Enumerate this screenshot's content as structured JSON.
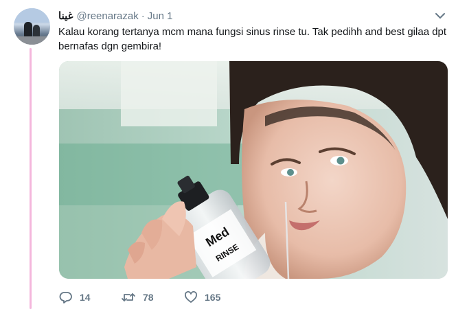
{
  "tweet": {
    "display_name": "غينا",
    "handle": "@reenarazak",
    "separator": "·",
    "date": "Jun 1",
    "text": "Kalau korang tertanya mcm mana fungsi sinus rinse tu. Tak pedihh and best gilaa dpt bernafas dgn gembira!",
    "media": {
      "bottle_label_1": "Med",
      "bottle_label_2": "RINSE"
    },
    "actions": {
      "reply_count": "14",
      "retweet_count": "78",
      "like_count": "165"
    }
  },
  "icons": {
    "caret": "chevron-down-icon",
    "reply": "reply-icon",
    "retweet": "retweet-icon",
    "like": "heart-icon"
  },
  "colors": {
    "thread_line": "#f4b6dc",
    "secondary_text": "#657786",
    "primary_text": "#14171a"
  }
}
